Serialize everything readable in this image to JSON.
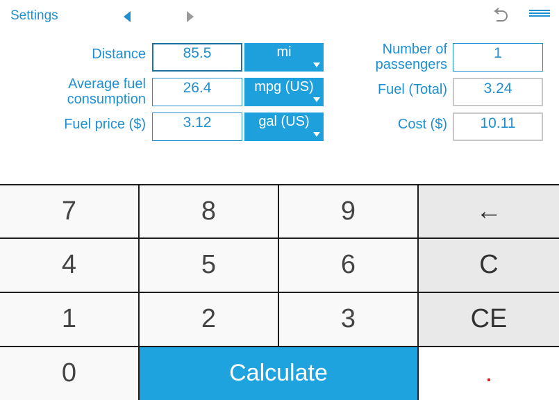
{
  "header": {
    "settings_label": "Settings"
  },
  "form": {
    "distance": {
      "label": "Distance",
      "value": "85.5",
      "unit": "mi"
    },
    "avg_fuel": {
      "label_line1": "Average fuel",
      "label_line2": "consumption",
      "value": "26.4",
      "unit": "mpg (US)"
    },
    "fuel_price": {
      "label": "Fuel price ($)",
      "value": "3.12",
      "unit": "gal (US)"
    },
    "passengers": {
      "label_line1": "Number of",
      "label_line2": "passengers",
      "value": "1"
    },
    "fuel_total": {
      "label": "Fuel (Total)",
      "value": "3.24"
    },
    "cost": {
      "label": "Cost ($)",
      "value": "10.11"
    }
  },
  "keypad": {
    "k7": "7",
    "k8": "8",
    "k9": "9",
    "backspace": "←",
    "k4": "4",
    "k5": "5",
    "k6": "6",
    "clear": "C",
    "k1": "1",
    "k2": "2",
    "k3": "3",
    "clear_entry": "CE",
    "k0": "0",
    "calculate": "Calculate",
    "decimal": "."
  },
  "colors": {
    "accent": "#1f8fd0",
    "unit_bg": "#1ea0dd",
    "calculate_bg": "#1fa3df",
    "decimal": "#d81b1b"
  }
}
